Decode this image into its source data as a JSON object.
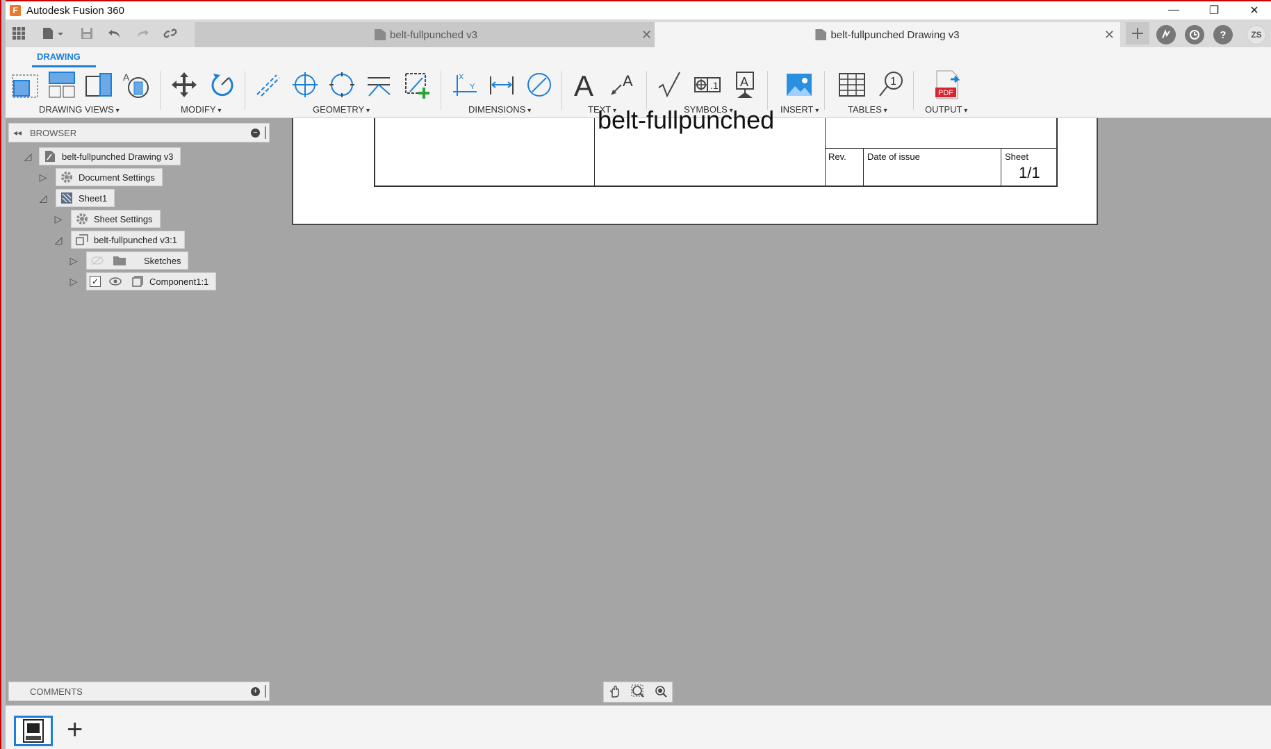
{
  "window": {
    "app_logo": "F",
    "title": "Autodesk Fusion 360",
    "controls": [
      "—",
      "❐",
      "✕"
    ]
  },
  "tabs": [
    {
      "label": "belt-fullpunched v3",
      "active": false
    },
    {
      "label": "belt-fullpunched Drawing v3",
      "active": true
    }
  ],
  "user_initials": "ZS",
  "ribbon": {
    "workspace_tab": "DRAWING",
    "groups": [
      "DRAWING VIEWS",
      "MODIFY",
      "GEOMETRY",
      "DIMENSIONS",
      "TEXT",
      "SYMBOLS",
      "INSERT",
      "TABLES",
      "OUTPUT"
    ],
    "pdf_label": "PDF"
  },
  "browser": {
    "title": "BROWSER",
    "items": [
      {
        "label": "belt-fullpunched Drawing v3"
      },
      {
        "label": "Document Settings"
      },
      {
        "label": "Sheet1"
      },
      {
        "label": "Sheet Settings"
      },
      {
        "label": "belt-fullpunched v3:1"
      },
      {
        "label": "Sketches"
      },
      {
        "label": "Component1:1"
      }
    ]
  },
  "comments": {
    "title": "COMMENTS"
  },
  "title_block": {
    "part_name": "belt-fullpunched",
    "rev_label": "Rev.",
    "date_label": "Date of issue",
    "sheet_label": "Sheet",
    "sheet_value": "1/1"
  },
  "colors": {
    "accent": "#1e7fd6",
    "canvas_bg": "#a5a5a5",
    "ribbon_bg": "#f4f4f4",
    "pdf_red": "#d9232d"
  }
}
